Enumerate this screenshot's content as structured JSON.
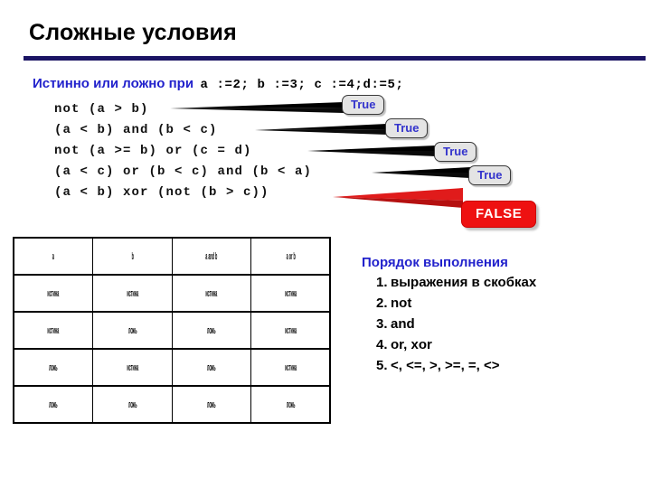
{
  "slide": {
    "title": "Сложные условия",
    "rule_color": "#1b1464"
  },
  "prompt": {
    "label": "Истинно или ложно при",
    "assignments": "a :=2;  b :=3;  c :=4;d:=5;",
    "label_color": "#2222cc"
  },
  "expressions": [
    {
      "code": "not (a > b)",
      "result": "True",
      "result_kind": "true"
    },
    {
      "code": "(a < b) and (b < c)",
      "result": "True",
      "result_kind": "true"
    },
    {
      "code": "not (a >= b) or (c = d)",
      "result": "True",
      "result_kind": "true"
    },
    {
      "code": "(a < c) or (b < c) and (b < a)",
      "result": "True",
      "result_kind": "true"
    },
    {
      "code": "(a < b) xor (not (b > c))",
      "result": "FALSE",
      "result_kind": "false"
    }
  ],
  "callout_colors": {
    "true_bg": "#e4e4e4",
    "true_text": "#3333cc",
    "false_bg": "#ee1111",
    "false_text": "#ffffff"
  },
  "truth_table": {
    "headers": [
      "a",
      "b",
      "a and b",
      "a or b"
    ],
    "rows": [
      [
        "истина",
        "истина",
        "истина",
        "истина"
      ],
      [
        "истина",
        "ложь",
        "ложь",
        "истина"
      ],
      [
        "ложь",
        "истина",
        "ложь",
        "истина"
      ],
      [
        "ложь",
        "ложь",
        "ложь",
        "ложь"
      ]
    ]
  },
  "order_panel": {
    "title": "Порядок выполнения",
    "items": [
      {
        "num": "1.",
        "text": "выражения в скобках"
      },
      {
        "num": "2.",
        "text": "not"
      },
      {
        "num": "3.",
        "text": "and"
      },
      {
        "num": "4.",
        "text": "or, xor"
      },
      {
        "num": "5.",
        "text": "<, <=, >, >=, =, <>"
      }
    ],
    "title_color": "#2222cc"
  }
}
